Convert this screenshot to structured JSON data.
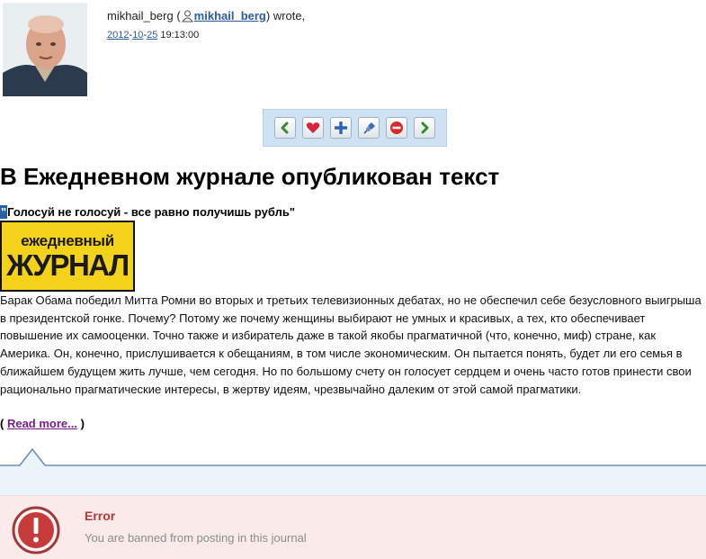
{
  "post": {
    "author": "mikhail_berg",
    "author_link": "mikhail_berg",
    "wrote": ") wrote,",
    "date_year": "2012",
    "date_month": "10",
    "date_day": "25",
    "time": "19:13:00"
  },
  "toolbar": {
    "icons": [
      "prev-icon",
      "favorite-icon",
      "add-icon",
      "tag-icon",
      "remove-icon",
      "next-icon"
    ]
  },
  "article": {
    "title": "В Ежедневном журнале опубликован текст",
    "quote_mark": "\"",
    "subtitle": "Голосуй не голосуй - все равно получишь рубль\"",
    "logo_line1": "ежедневный",
    "logo_line2": "ЖУРНАЛ",
    "body": "Барак Обама победил Митта Ромни во вторых и третьих телевизионных дебатах, но не обеспечил себе безусловного выигрыша в президентской гонке. Почему? Потому же почему женщины выбирают не умных и красивых, а тех, кто обеспечивает повышение их самооценки. Точно также и избиратель даже в такой якобы прагматичной (что, конечно, миф) стране, как Америка. Он, конечно, прислушивается к обещаниям, в том числе экономическим. Он пытается понять,  будет ли его семья в  ближайшем будущем жить лучше, чем сегодня. Но по большому счету он голосует сердцем и очень часто готов принести свои рационально прагматические интересы, в жертву идеям, чрезвычайно далеким от этой самой прагматики.",
    "read_open": "( ",
    "read_more": "Read more...",
    "read_close": " )"
  },
  "error": {
    "title": "Error",
    "message": "You are banned from posting in this journal"
  },
  "colors": {
    "link": "#2a5d9c",
    "visited_link": "#7a1d8c",
    "error_bg": "#fbeaea",
    "error_title": "#b13a3a",
    "toolbar_bg": "#cfe2f3"
  }
}
